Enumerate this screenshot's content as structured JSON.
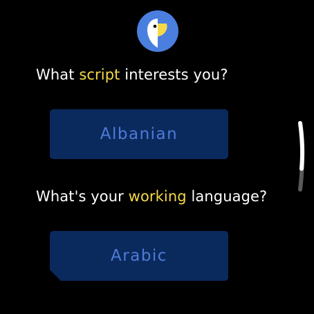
{
  "logo": {
    "icon": "parrot-logo-icon"
  },
  "questions": [
    {
      "before": "What ",
      "highlight": "script",
      "after": " interests you?"
    },
    {
      "before": "What's your ",
      "highlight": "working",
      "after": " language?"
    }
  ],
  "selections": [
    {
      "label": "Albanian"
    },
    {
      "label": "Arabic"
    }
  ],
  "colors": {
    "background": "#000000",
    "text": "#ffffff",
    "accent": "#f5d94a",
    "button_bg": "#0a2a5e",
    "button_text": "#4f7bd8",
    "logo_blue": "#4a7fe0"
  },
  "scroll": {
    "position": 0.0
  }
}
